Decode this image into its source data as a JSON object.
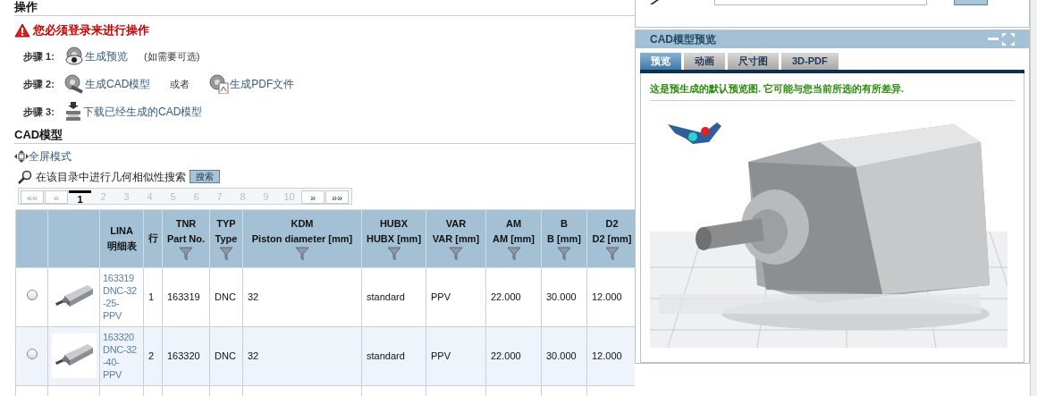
{
  "operations": {
    "heading": "操作",
    "warning": "您必须登录来进行操作",
    "steps": [
      {
        "label": "步骤 1:",
        "actions": [
          {
            "kind": "preview",
            "text": "生成预览"
          }
        ],
        "note": "(如需要可选)"
      },
      {
        "label": "步骤 2:",
        "actions": [
          {
            "kind": "cad",
            "text": "生成CAD模型"
          },
          {
            "kind": "pdf",
            "text": "生成PDF文件"
          }
        ],
        "separator": "或者"
      },
      {
        "label": "步骤 3:",
        "actions": [
          {
            "kind": "download",
            "text": "下载已经生成的CAD模型"
          }
        ]
      }
    ]
  },
  "cad_model": {
    "heading": "CAD模型",
    "fullscreen": "全屏模式",
    "geo_search": "在该目录中进行几何相似性搜索",
    "search_button": "搜索",
    "pagination": [
      {
        "label": "««",
        "selected": false
      },
      {
        "label": "«",
        "selected": false
      },
      {
        "label": "1",
        "selected": true
      },
      {
        "label": "2",
        "selected": false
      },
      {
        "label": "3",
        "selected": false
      },
      {
        "label": "4",
        "selected": false
      },
      {
        "label": "5",
        "selected": false
      },
      {
        "label": "6",
        "selected": false
      },
      {
        "label": "7",
        "selected": false
      },
      {
        "label": "8",
        "selected": false
      },
      {
        "label": "9",
        "selected": false
      },
      {
        "label": "10",
        "selected": false
      },
      {
        "label": "»",
        "selected": false
      },
      {
        "label": "»»",
        "selected": false
      }
    ],
    "table": {
      "columns": [
        {
          "filter": false
        },
        {
          "filter": false
        },
        {
          "lines": [
            "LINA",
            "明细表"
          ],
          "filter": false
        },
        {
          "lines": [
            "行"
          ],
          "filter": false
        },
        {
          "lines": [
            "TNR",
            "Part No."
          ],
          "filter": true
        },
        {
          "lines": [
            "TYP",
            "Type"
          ],
          "filter": true
        },
        {
          "lines": [
            "KDM",
            "Piston diameter [mm]"
          ],
          "filter": true
        },
        {
          "lines": [
            "HUBX",
            "HUBX [mm]"
          ],
          "filter": true
        },
        {
          "lines": [
            "VAR",
            "VAR [mm]"
          ],
          "filter": true
        },
        {
          "lines": [
            "AM",
            "AM [mm]"
          ],
          "filter": true
        },
        {
          "lines": [
            "B",
            "B [mm]"
          ],
          "filter": true
        },
        {
          "lines": [
            "D2",
            "D2 [mm]"
          ],
          "filter": true
        }
      ],
      "rows": [
        {
          "selected": false,
          "cells": [
            "",
            "",
            "163319\nDNC-32\n-25-\nPPV",
            "1",
            "163319",
            "DNC",
            "32",
            "standard",
            "PPV",
            "22.000",
            "30.000",
            "12.000"
          ]
        },
        {
          "selected": false,
          "cells": [
            "",
            "",
            "163320\nDNC-32\n-40-\nPPV",
            "2",
            "163320",
            "DNC",
            "32",
            "standard",
            "PPV",
            "22.000",
            "30.000",
            "12.000"
          ]
        }
      ]
    }
  },
  "preview_panel": {
    "title": "CAD模型预览",
    "tabs": [
      {
        "label": "预览",
        "selected": true
      },
      {
        "label": "动画",
        "selected": false
      },
      {
        "label": "尺寸图",
        "selected": false
      },
      {
        "label": "3D-PDF",
        "selected": false
      }
    ],
    "message": "这是预生成的默认预览图. 它可能与您当前所选的有所差异."
  }
}
